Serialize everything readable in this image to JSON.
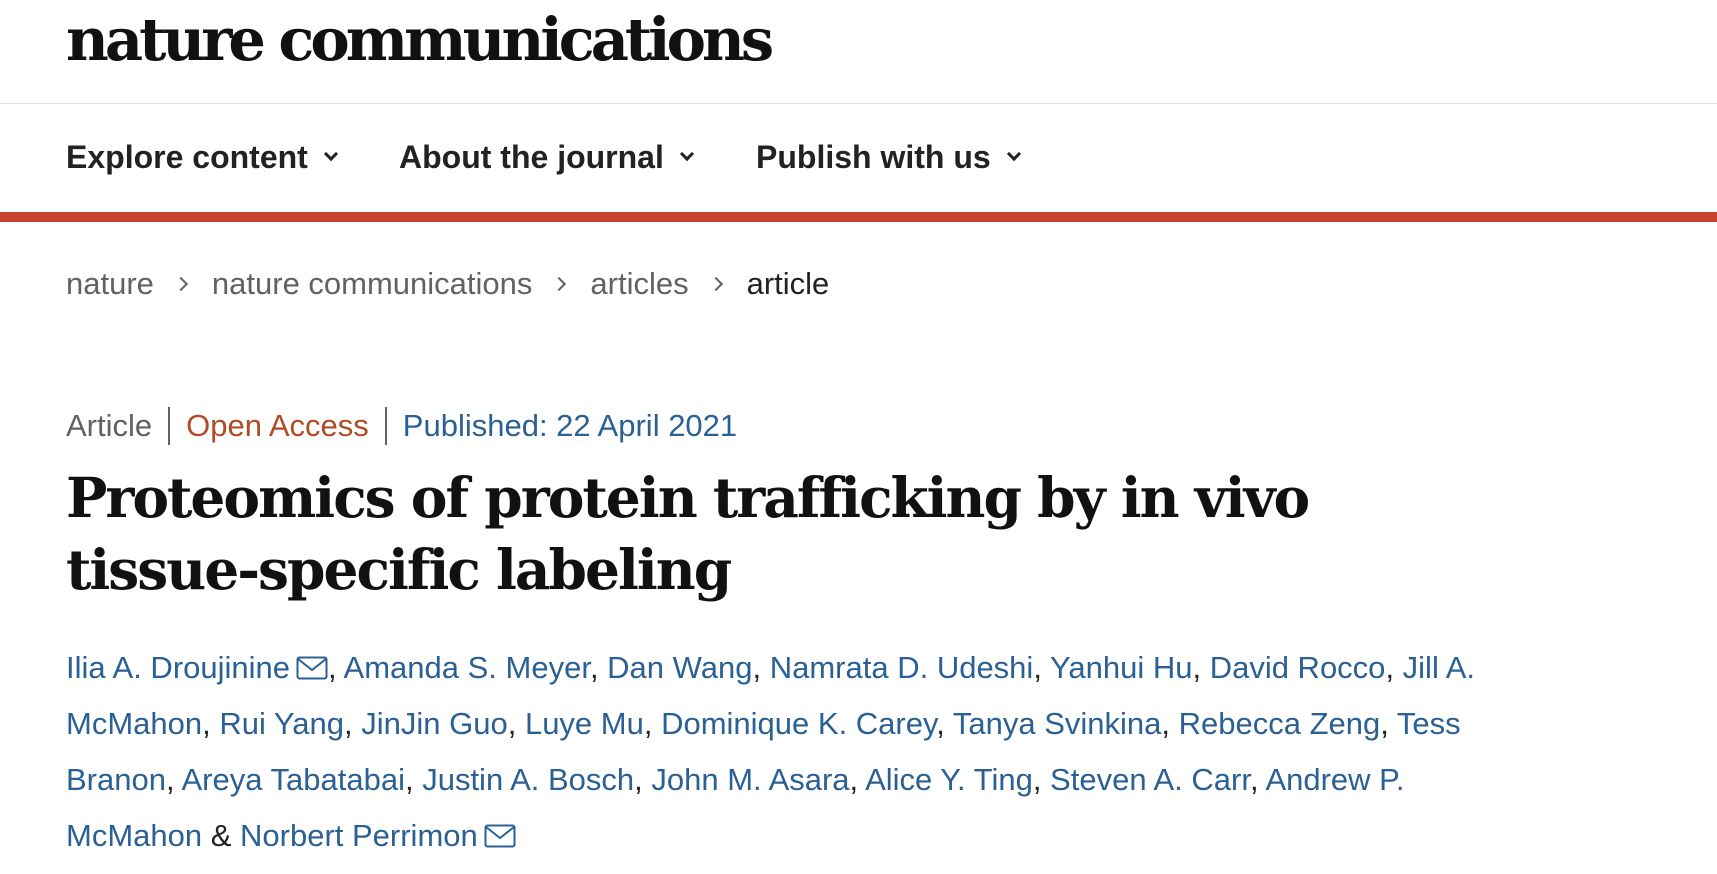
{
  "brand": {
    "logo_text": "nature communications"
  },
  "nav": {
    "items": [
      {
        "label": "Explore content"
      },
      {
        "label": "About the journal"
      },
      {
        "label": "Publish with us"
      }
    ]
  },
  "breadcrumb": {
    "items": [
      "nature",
      "nature communications",
      "articles"
    ],
    "current": "article"
  },
  "article": {
    "type": "Article",
    "access": "Open Access",
    "published": "Published: 22 April 2021",
    "title": "Proteomics of protein trafficking by in vivo tissue-specific labeling",
    "authors": [
      {
        "name": "Ilia A. Droujinine",
        "icon": "mail-icon"
      },
      {
        "name": "Amanda S. Meyer"
      },
      {
        "name": "Dan Wang"
      },
      {
        "name": "Namrata D. Udeshi"
      },
      {
        "name": "Yanhui Hu"
      },
      {
        "name": "David Rocco"
      },
      {
        "name": "Jill A. McMahon"
      },
      {
        "name": "Rui Yang"
      },
      {
        "name": "JinJin Guo"
      },
      {
        "name": "Luye Mu"
      },
      {
        "name": "Dominique K. Carey"
      },
      {
        "name": "Tanya Svinkina"
      },
      {
        "name": "Rebecca Zeng"
      },
      {
        "name": "Tess Branon"
      },
      {
        "name": "Areya Tabatabai"
      },
      {
        "name": "Justin A. Bosch"
      },
      {
        "name": "John M. Asara"
      },
      {
        "name": "Alice Y. Ting"
      },
      {
        "name": "Steven A. Carr"
      },
      {
        "name": "Andrew P. McMahon"
      },
      {
        "name": "Norbert Perrimon",
        "icon": "mail-icon"
      }
    ],
    "separator": ", ",
    "last_separator": " & "
  },
  "colors": {
    "accent_bar": "#c8412f",
    "open_access": "#b24a25",
    "link": "#2b6094",
    "text": "#222222",
    "muted": "#626262"
  }
}
